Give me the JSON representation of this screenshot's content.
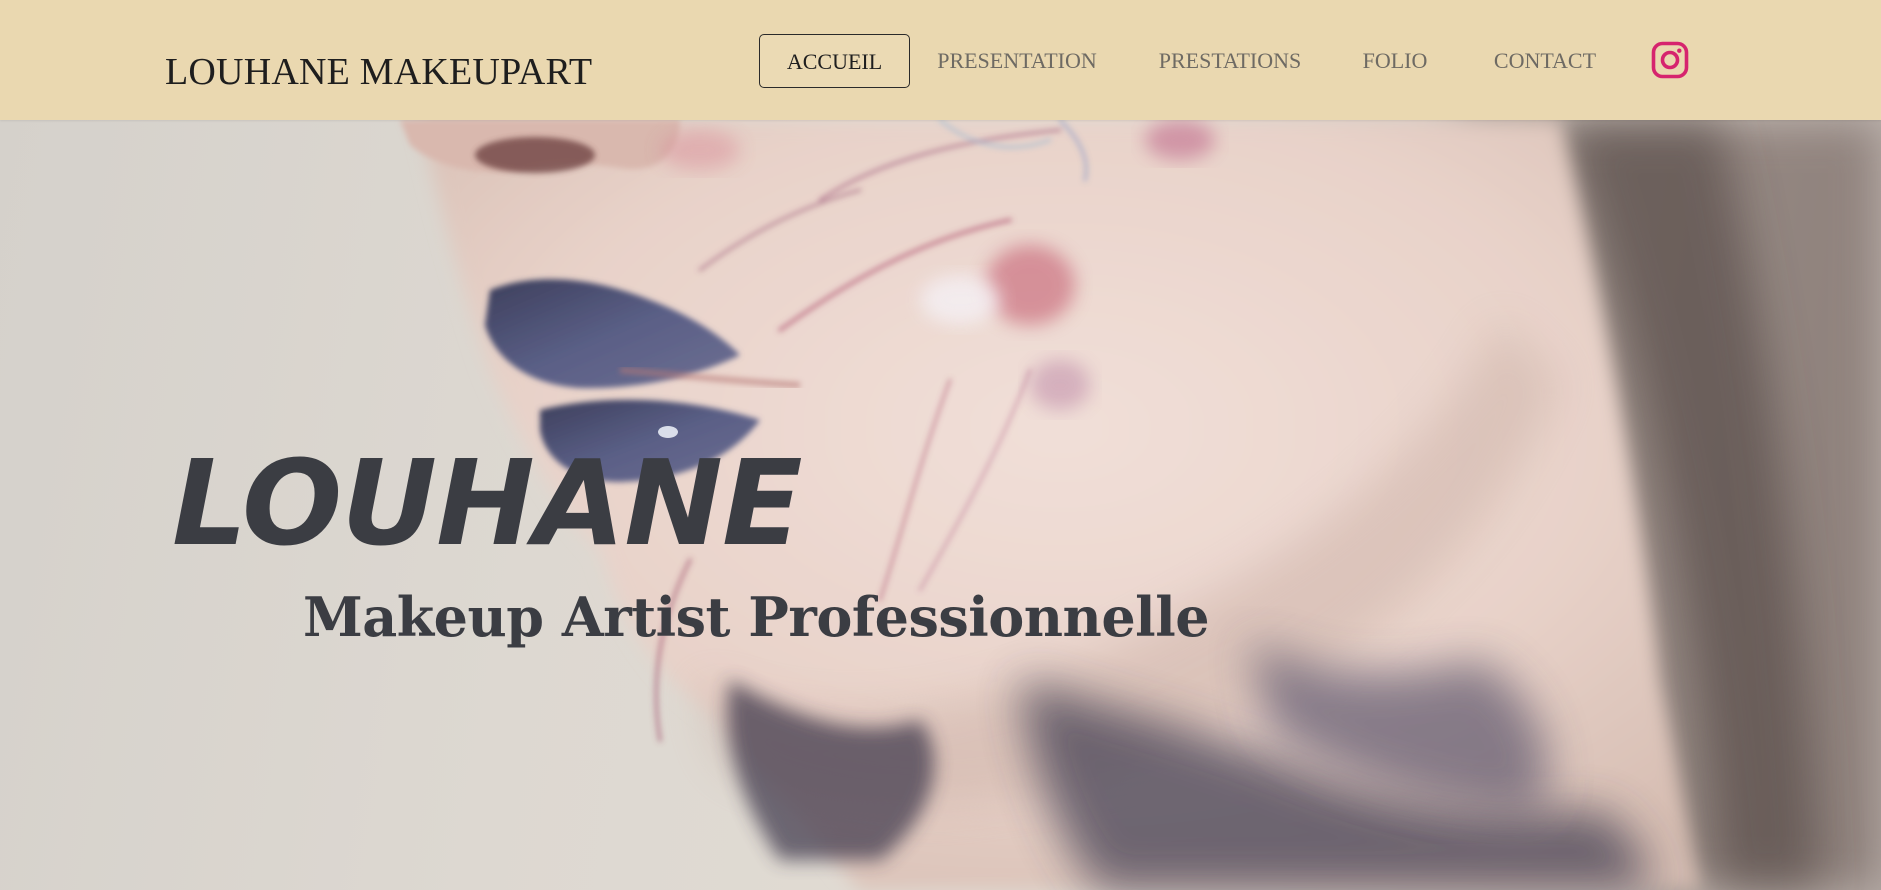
{
  "header": {
    "brand": "LOUHANE MAKEUPART",
    "nav": [
      {
        "label": "ACCUEIL",
        "active": true
      },
      {
        "label": "PRESENTATION",
        "active": false
      },
      {
        "label": "PRESTATIONS",
        "active": false
      },
      {
        "label": "FOLIO",
        "active": false
      },
      {
        "label": "CONTACT",
        "active": false
      }
    ],
    "social_icon": "instagram-icon"
  },
  "hero": {
    "title": "LOUHANE",
    "subtitle": "Makeup Artist Professionnelle",
    "background_image": "close-up of face with watercolor makeup"
  },
  "colors": {
    "header_bg": "#ead8b0",
    "text_dark": "#3b3d43",
    "nav_text": "#6e6a63",
    "instagram": "#d6246e"
  }
}
